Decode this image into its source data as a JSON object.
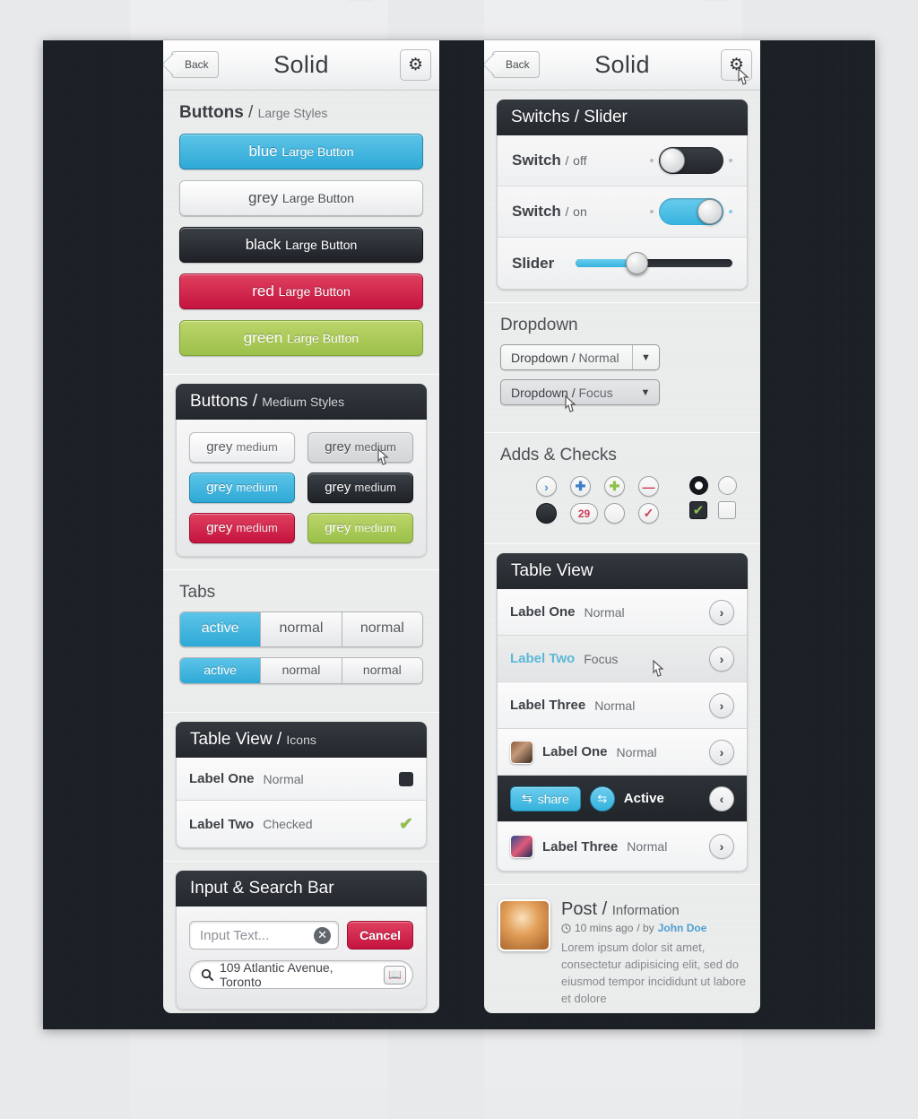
{
  "nav": {
    "back": "Back",
    "title": "Solid",
    "gear_icon": "gear-icon"
  },
  "left": {
    "buttons_large": {
      "heading_main": "Buttons",
      "heading_sep": "/",
      "heading_sub": "Large Styles",
      "items": [
        {
          "color": "blue",
          "label": "blue",
          "sub": "Large Button"
        },
        {
          "color": "grey",
          "label": "grey",
          "sub": "Large Button"
        },
        {
          "color": "black",
          "label": "black",
          "sub": "Large Button"
        },
        {
          "color": "red",
          "label": "red",
          "sub": "Large Button"
        },
        {
          "color": "green",
          "label": "green",
          "sub": "Large Button"
        }
      ]
    },
    "buttons_medium": {
      "title_main": "Buttons",
      "title_sep": "/",
      "title_sub": "Medium Styles",
      "items": [
        {
          "color": "grey1",
          "label": "grey",
          "sub": "medium"
        },
        {
          "color": "grey2",
          "label": "grey",
          "sub": "medium"
        },
        {
          "color": "blue",
          "label": "grey",
          "sub": "medium"
        },
        {
          "color": "black",
          "label": "grey",
          "sub": "medium"
        },
        {
          "color": "red",
          "label": "grey",
          "sub": "medium"
        },
        {
          "color": "green",
          "label": "grey",
          "sub": "medium"
        }
      ]
    },
    "tabs": {
      "heading": "Tabs",
      "row1": [
        {
          "label": "active",
          "state": "active"
        },
        {
          "label": "normal",
          "state": "normal"
        },
        {
          "label": "normal",
          "state": "normal"
        }
      ],
      "row2": [
        {
          "label": "active",
          "state": "active"
        },
        {
          "label": "normal",
          "state": "normal"
        },
        {
          "label": "normal",
          "state": "normal"
        }
      ]
    },
    "table_icons": {
      "title_main": "Table View",
      "title_sep": "/",
      "title_sub": "Icons",
      "rows": [
        {
          "label": "Label One",
          "value": "Normal",
          "icon": "dark-square"
        },
        {
          "label": "Label Two",
          "value": "Checked",
          "icon": "green-check"
        }
      ]
    },
    "input_search": {
      "title": "Input & Search Bar",
      "input_placeholder": "Input Text...",
      "input_value": "",
      "clear_icon": "clear-x-icon",
      "cancel_label": "Cancel",
      "search_icon": "search-icon",
      "search_value": "109 Atlantic Avenue, Toronto",
      "bookmark_icon": "bookmark-icon"
    }
  },
  "right": {
    "switches": {
      "title": "Switchs / Slider",
      "rows": [
        {
          "label": "Switch",
          "sep": "/",
          "sub": "off",
          "state": "off"
        },
        {
          "label": "Switch",
          "sep": "/",
          "sub": "on",
          "state": "on"
        }
      ],
      "slider_label": "Slider",
      "slider_value": 38
    },
    "dropdown": {
      "heading": "Dropdown",
      "items": [
        {
          "label": "Dropdown",
          "sep": "/",
          "sub": "Normal",
          "state": "normal"
        },
        {
          "label": "Dropdown",
          "sep": "/",
          "sub": "Focus",
          "state": "focus"
        }
      ],
      "chevron_icon": "chevron-down-icon"
    },
    "adds_checks": {
      "heading": "Adds & Checks",
      "row1": [
        {
          "glyph": "›",
          "name": "chevron-right-badge",
          "style": "blue-t"
        },
        {
          "glyph": "✚",
          "name": "plus-badge-blue",
          "style": "blue-p"
        },
        {
          "glyph": "✚",
          "name": "plus-badge-green",
          "style": "green-p"
        },
        {
          "glyph": "—",
          "name": "minus-badge-red",
          "style": "red-m"
        }
      ],
      "row2": [
        {
          "glyph": "",
          "name": "filled-dark-circle",
          "style": "filled"
        },
        {
          "glyph": "29",
          "name": "count-badge",
          "style": "red-n"
        },
        {
          "glyph": "",
          "name": "empty-circle",
          "style": ""
        },
        {
          "glyph": "✓",
          "name": "check-badge-red",
          "style": "red-c"
        }
      ],
      "radios": [
        {
          "name": "radio-selected",
          "state": "on"
        },
        {
          "name": "radio-unselected",
          "state": "off"
        }
      ],
      "checkboxes": [
        {
          "name": "checkbox-checked",
          "state": "on",
          "glyph": "✔"
        },
        {
          "name": "checkbox-unchecked",
          "state": "off",
          "glyph": ""
        }
      ]
    },
    "table_view": {
      "title": "Table View",
      "rows": [
        {
          "label": "Label One",
          "value": "Normal",
          "state": "normal",
          "avatar": "",
          "chevron": "›"
        },
        {
          "label": "Label Two",
          "value": "Focus",
          "state": "focus",
          "avatar": "",
          "chevron": "›"
        },
        {
          "label": "Label Three",
          "value": "Normal",
          "state": "normal",
          "avatar": "",
          "chevron": "›"
        },
        {
          "label": "Label One",
          "value": "Normal",
          "state": "normal",
          "avatar": "av1",
          "chevron": "›"
        },
        {
          "label": "",
          "value": "Active",
          "state": "active",
          "avatar": "",
          "chevron": "‹",
          "share_label": "share",
          "share_icon": "shuffle-icon"
        },
        {
          "label": "Label Three",
          "value": "Normal",
          "state": "normal",
          "avatar": "av2",
          "chevron": "›"
        }
      ]
    },
    "post": {
      "title_main": "Post",
      "title_sep": "/",
      "title_sub": "Information",
      "clock_icon": "clock-icon",
      "meta_time": "10 mins ago",
      "meta_sep": "/ by",
      "meta_author": "John Doe",
      "body": "Lorem ipsum dolor sit amet, consectetur adipisicing elit, sed do eiusmod tempor incididunt ut labore et dolore"
    }
  },
  "colors": {
    "accent_blue": "#2fa9d6",
    "red": "#c5133f",
    "green": "#9cc04a",
    "black": "#1e2227",
    "stage_bg": "#1b2026",
    "panel_bg": "#eceded"
  }
}
